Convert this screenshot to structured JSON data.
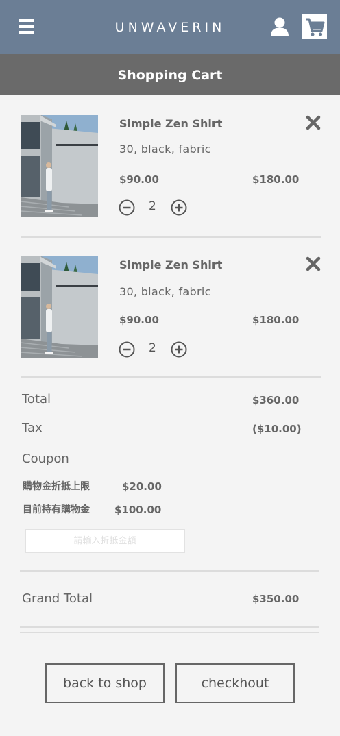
{
  "header": {
    "brand": "UNWAVERIN",
    "menu_icon": "hamburger-icon",
    "user_icon": "user-icon",
    "cart_icon": "shopping-cart-icon"
  },
  "page_title": "Shopping Cart",
  "items": [
    {
      "name": "Simple Zen Shirt",
      "variant": "30, black, fabric",
      "unit_price": "$90.00",
      "line_total": "$180.00",
      "quantity": "2"
    },
    {
      "name": "Simple Zen Shirt",
      "variant": "30, black, fabric",
      "unit_price": "$90.00",
      "line_total": "$180.00",
      "quantity": "2"
    }
  ],
  "summary": {
    "total_label": "Total",
    "total_value": "$360.00",
    "tax_label": "Tax",
    "tax_value": "($10.00)",
    "coupon_label": "Coupon",
    "coupon_limit_label": "購物金折抵上限",
    "coupon_limit_value": "$20.00",
    "coupon_balance_label": "目前持有購物金",
    "coupon_balance_value": "$100.00",
    "coupon_placeholder": "請輸入折抵金額",
    "grand_total_label": "Grand Total",
    "grand_total_value": "$350.00"
  },
  "actions": {
    "back_label": "back to shop",
    "checkout_label": "checkhout"
  },
  "colors": {
    "header_bg": "#6b7e95",
    "subheader_bg": "#6a6a6a",
    "page_bg": "#f4f4f4",
    "text": "#666666"
  }
}
